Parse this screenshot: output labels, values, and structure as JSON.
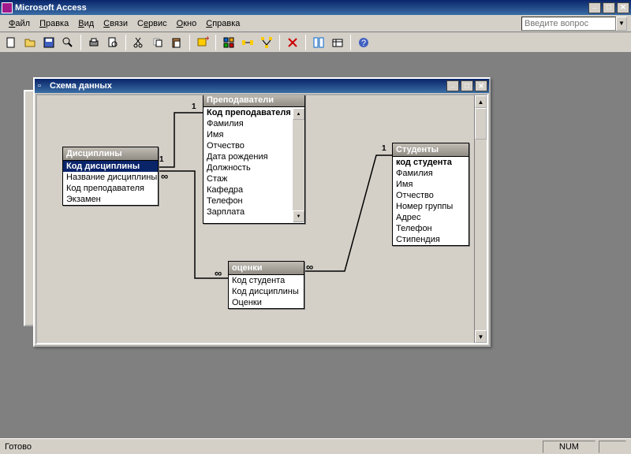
{
  "app": {
    "title": "Microsoft Access"
  },
  "menu": {
    "file": "Файл",
    "edit": "Правка",
    "view": "Вид",
    "relations": "Связи",
    "service": "Сервис",
    "window": "Окно",
    "help": "Справка"
  },
  "ask": {
    "placeholder": "Введите вопрос"
  },
  "schema": {
    "title": "Схема данных",
    "tables": {
      "disciplines": {
        "title": "Дисциплины",
        "fields": [
          "Код дисциплины",
          "Название дисциплины",
          "Код преподавателя",
          "Экзамен"
        ],
        "pk": 0,
        "sel": 0
      },
      "teachers": {
        "title": "Преподаватели",
        "fields": [
          "Код преподавателя",
          "Фамилия",
          "Имя",
          "Отчество",
          "Дата рождения",
          "Должность",
          "Стаж",
          "Кафедра",
          "Телефон",
          "Зарплата"
        ],
        "pk": 0
      },
      "grades": {
        "title": "оценки",
        "fields": [
          "Код студента",
          "Код дисциплины",
          "Оценки"
        ]
      },
      "students": {
        "title": "Студенты",
        "fields": [
          "код студента",
          "Фамилия",
          "Имя",
          "Отчество",
          "Номер группы",
          "Адрес",
          "Телефон",
          "Стипендия"
        ],
        "pk": 0
      }
    },
    "rel_labels": {
      "one": "1",
      "many": "∞"
    }
  },
  "status": {
    "ready": "Готово",
    "num": "NUM"
  }
}
